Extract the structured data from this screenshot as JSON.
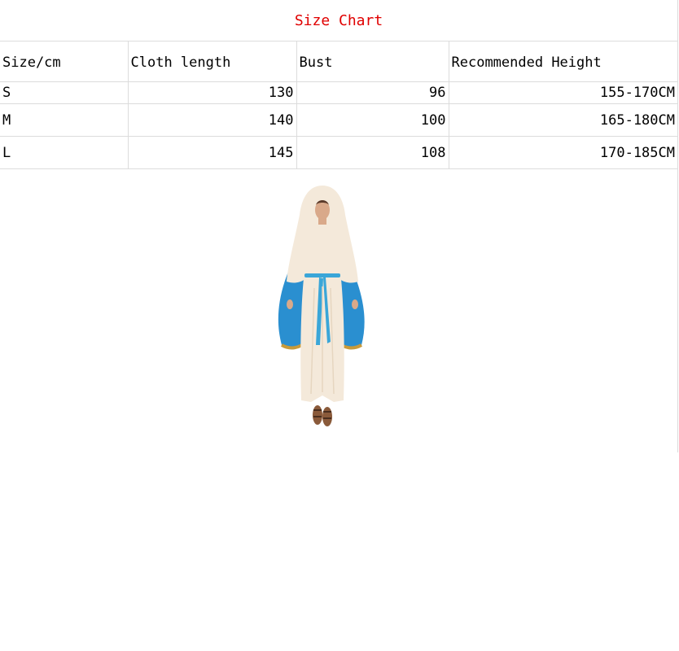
{
  "title": "Size Chart",
  "accent_color": "#e00000",
  "table": {
    "headers": [
      "Size/cm",
      "Cloth length",
      "Bust",
      "Recommended Height"
    ],
    "rows": [
      {
        "size": "S",
        "length": "130",
        "bust": "96",
        "height": "155-170CM"
      },
      {
        "size": "M",
        "length": "140",
        "bust": "100",
        "height": "165-180CM"
      },
      {
        "size": "L",
        "length": "145",
        "bust": "108",
        "height": "170-185CM"
      }
    ]
  },
  "product_image": {
    "icon": "robed-figure-costume",
    "colors": {
      "robe": "#f4e9da",
      "mantle": "#2a8fd0",
      "trim": "#c89a3a",
      "sash": "#3aa6d8"
    }
  }
}
